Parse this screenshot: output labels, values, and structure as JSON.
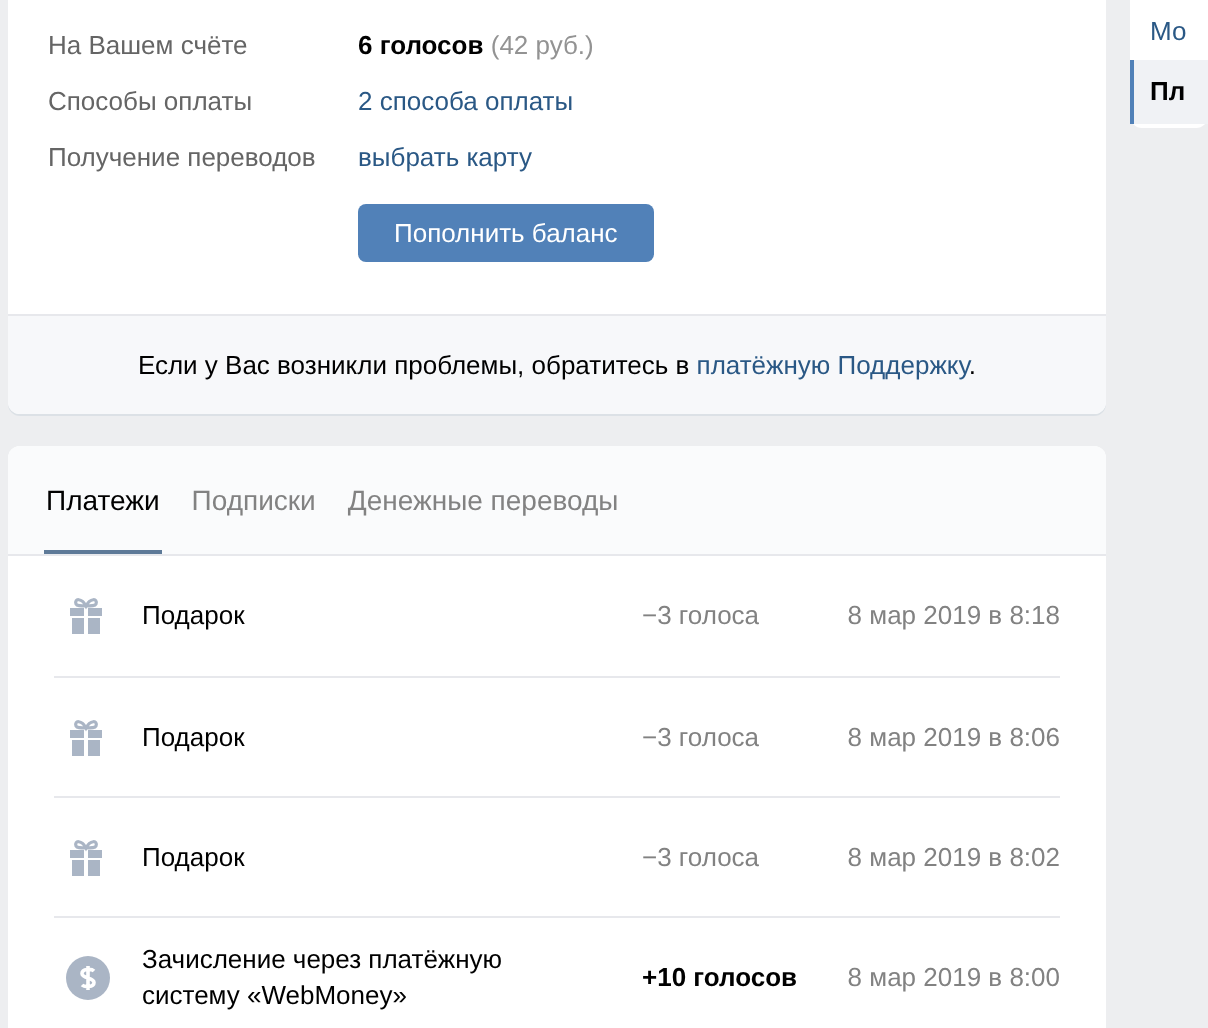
{
  "account": {
    "rows": [
      {
        "label": "На Вашем счёте",
        "kind": "balance",
        "value": "6 голосов",
        "note": "(42 руб.)"
      },
      {
        "label": "Способы оплаты",
        "kind": "link",
        "value": "2 способа оплаты"
      },
      {
        "label": "Получение переводов",
        "kind": "link",
        "value": "выбрать карту"
      }
    ],
    "button": "Пополнить баланс",
    "help": {
      "text": "Если у Вас возникли проблемы, обратитесь в ",
      "link": "платёжную Поддержку",
      "end": "."
    }
  },
  "tabs": [
    {
      "label": "Платежи",
      "selected": true
    },
    {
      "label": "Подписки",
      "selected": false
    },
    {
      "label": "Денежные переводы",
      "selected": false
    }
  ],
  "payments": [
    {
      "kind": "gift",
      "title": "Подарок",
      "amount": "−3 голоса",
      "positive": false,
      "date": "8 мар 2019 в 8:18"
    },
    {
      "kind": "gift",
      "title": "Подарок",
      "amount": "−3 голоса",
      "positive": false,
      "date": "8 мар 2019 в 8:06"
    },
    {
      "kind": "gift",
      "title": "Подарок",
      "amount": "−3 голоса",
      "positive": false,
      "date": "8 мар 2019 в 8:02"
    },
    {
      "kind": "deposit",
      "title": "Зачисление через платёжную систему «WebMoney»",
      "amount": "+10 голосов",
      "positive": true,
      "date": "8 мар 2019 в 8:00"
    }
  ],
  "sidebar": {
    "items": [
      {
        "label": "Мо",
        "selected": false
      },
      {
        "label": "Пл",
        "selected": true
      }
    ]
  }
}
